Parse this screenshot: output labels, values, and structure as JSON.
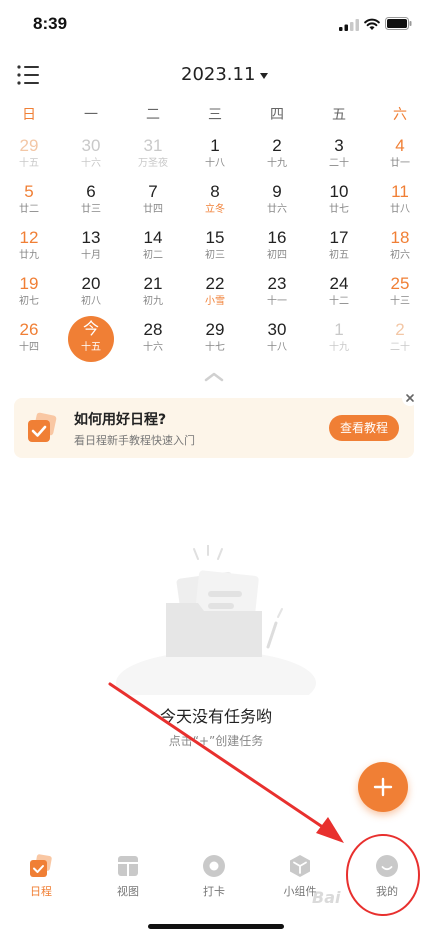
{
  "status_bar": {
    "time": "8:39"
  },
  "header": {
    "month": "2023.11"
  },
  "weekdays": [
    "日",
    "一",
    "二",
    "三",
    "四",
    "五",
    "六"
  ],
  "calendar": {
    "weeks": [
      [
        {
          "day": "29",
          "lunar": "十五",
          "dim": true
        },
        {
          "day": "30",
          "lunar": "十六",
          "dim": true
        },
        {
          "day": "31",
          "lunar": "万圣夜",
          "dim": true
        },
        {
          "day": "1",
          "lunar": "十八"
        },
        {
          "day": "2",
          "lunar": "十九"
        },
        {
          "day": "3",
          "lunar": "二十"
        },
        {
          "day": "4",
          "lunar": "廿一"
        }
      ],
      [
        {
          "day": "5",
          "lunar": "廿二"
        },
        {
          "day": "6",
          "lunar": "廿三"
        },
        {
          "day": "7",
          "lunar": "廿四"
        },
        {
          "day": "8",
          "lunar": "立冬",
          "festival": true
        },
        {
          "day": "9",
          "lunar": "廿六"
        },
        {
          "day": "10",
          "lunar": "廿七"
        },
        {
          "day": "11",
          "lunar": "廿八"
        }
      ],
      [
        {
          "day": "12",
          "lunar": "廿九"
        },
        {
          "day": "13",
          "lunar": "十月"
        },
        {
          "day": "14",
          "lunar": "初二"
        },
        {
          "day": "15",
          "lunar": "初三"
        },
        {
          "day": "16",
          "lunar": "初四"
        },
        {
          "day": "17",
          "lunar": "初五"
        },
        {
          "day": "18",
          "lunar": "初六"
        }
      ],
      [
        {
          "day": "19",
          "lunar": "初七"
        },
        {
          "day": "20",
          "lunar": "初八"
        },
        {
          "day": "21",
          "lunar": "初九"
        },
        {
          "day": "22",
          "lunar": "小雪",
          "festival": true
        },
        {
          "day": "23",
          "lunar": "十一"
        },
        {
          "day": "24",
          "lunar": "十二"
        },
        {
          "day": "25",
          "lunar": "十三"
        }
      ],
      [
        {
          "day": "26",
          "lunar": "十四"
        },
        {
          "day": "今",
          "lunar": "十五",
          "today": true
        },
        {
          "day": "28",
          "lunar": "十六"
        },
        {
          "day": "29",
          "lunar": "十七"
        },
        {
          "day": "30",
          "lunar": "十八"
        },
        {
          "day": "1",
          "lunar": "十九",
          "dim": true
        },
        {
          "day": "2",
          "lunar": "二十",
          "dim": true
        }
      ]
    ]
  },
  "promo": {
    "title": "如何用好日程?",
    "subtitle": "看日程新手教程快速入门",
    "button": "查看教程"
  },
  "empty_state": {
    "title": "今天没有任务哟",
    "hint": "点击“+”创建任务"
  },
  "tabs": [
    {
      "label": "日程",
      "icon": "calendar-check-icon",
      "active": true
    },
    {
      "label": "视图",
      "icon": "view-grid-icon"
    },
    {
      "label": "打卡",
      "icon": "checkin-circle-icon"
    },
    {
      "label": "小组件",
      "icon": "widget-cube-icon"
    },
    {
      "label": "我的",
      "icon": "profile-face-icon"
    }
  ],
  "colors": {
    "accent": "#f07f35",
    "annotation": "#e8302e",
    "promo_bg": "#fdf5e9"
  },
  "watermark": "Bai"
}
